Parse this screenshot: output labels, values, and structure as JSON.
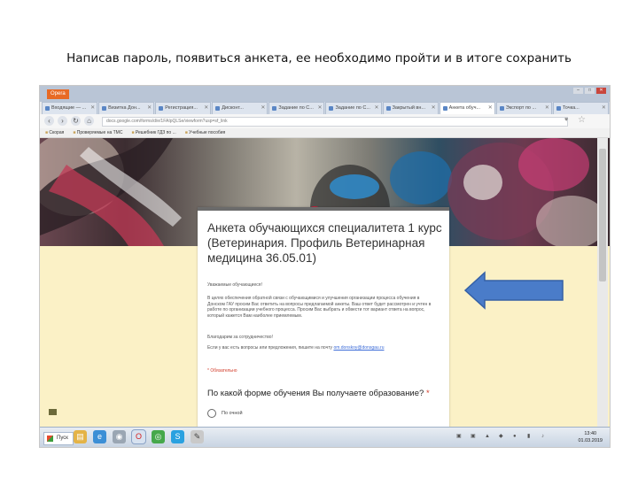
{
  "slide": {
    "title": "Написав пароль, появиться анкета, ее необходимо пройти и в итоге сохранить"
  },
  "browser": {
    "app_menu": "Opera",
    "tabs": [
      {
        "label": "Входящие — ...",
        "active": false
      },
      {
        "label": "Визитка Дон...",
        "active": false
      },
      {
        "label": "Регистрация...",
        "active": false
      },
      {
        "label": "Дисконт...",
        "active": false
      },
      {
        "label": "Задание по С...",
        "active": false
      },
      {
        "label": "Задание по С...",
        "active": false
      },
      {
        "label": "Закрытый вн...",
        "active": false
      },
      {
        "label": "Анкета обуч...",
        "active": true
      },
      {
        "label": "Экспорт по ...",
        "active": false
      },
      {
        "label": "Точка...",
        "active": false
      }
    ],
    "url": "docs.google.com/forms/d/e/1FAIpQLSe/viewform?usp=sf_link",
    "bookmarks": [
      "Скорая",
      "Проверяемые на ТМС",
      "Решебник ГДЗ по ...",
      "Учебные пособия"
    ]
  },
  "form": {
    "title": "Анкета обучающихся специалитета 1 курс (Ветеринария. Профиль Ветеринарная медицина 36.05.01)",
    "greeting": "Уважаемые обучающиеся!",
    "description": "В целях обеспечения обратной связи с обучающимися и улучшения организации процесса обучения в Донском ГАУ просим Вас ответить на вопросы предлагаемой анкеты. Ваш ответ будет рассмотрен и учтен в работе по организации учебного процесса. Просим Вас выбрать и обвести тот вариант ответа на вопрос, который кажется Вам наиболее приемлемым.",
    "thanks": "Благодарим за сотрудничество!",
    "contact_text": "Если у вас есть вопросы или предложения, пишите на почту",
    "contact_link": "om.donskoy@donsgau.ru",
    "required_note": "* Обязательно",
    "question": "По какой форме обучения Вы получаете образование?",
    "required_mark": "*",
    "option_first": "По очной"
  },
  "taskbar": {
    "start_label": "Пуск",
    "time": "13:40",
    "date": "01.03.2019"
  }
}
